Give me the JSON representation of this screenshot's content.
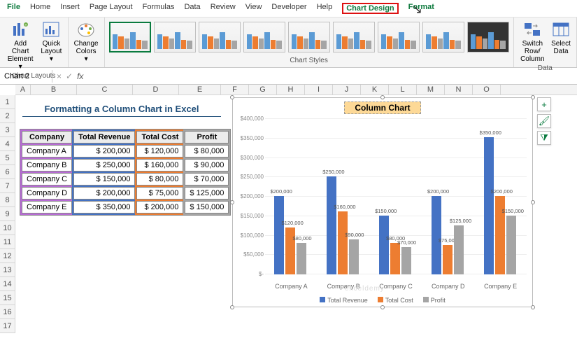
{
  "menu": {
    "file": "File",
    "home": "Home",
    "insert": "Insert",
    "pagelayout": "Page Layout",
    "formulas": "Formulas",
    "data": "Data",
    "review": "Review",
    "view": "View",
    "developer": "Developer",
    "help": "Help",
    "chartdesign": "Chart Design",
    "format": "Format"
  },
  "ribbon": {
    "addchart": "Add Chart\nElement ▾",
    "quicklayout": "Quick\nLayout ▾",
    "changecolors": "Change\nColors ▾",
    "switch": "Switch Row/\nColumn",
    "selectdata": "Select\nData",
    "g1": "Chart Layouts",
    "g2": "Chart Styles",
    "g3": "Data"
  },
  "namebox": "Chart 2",
  "titleblock": "Formatting a Column Chart in Excel",
  "headers": {
    "company": "Company",
    "rev": "Total Revenue",
    "cost": "Total Cost",
    "profit": "Profit"
  },
  "rows": [
    {
      "c": "Company A",
      "r": "$     200,000",
      "t": "$   120,000",
      "p": "$     80,000"
    },
    {
      "c": "Company B",
      "r": "$     250,000",
      "t": "$   160,000",
      "p": "$     90,000"
    },
    {
      "c": "Company C",
      "r": "$     150,000",
      "t": "$     80,000",
      "p": "$     70,000"
    },
    {
      "c": "Company D",
      "r": "$     200,000",
      "t": "$     75,000",
      "p": "$   125,000"
    },
    {
      "c": "Company E",
      "r": "$     350,000",
      "t": "$   200,000",
      "p": "$   150,000"
    }
  ],
  "chart": {
    "title": "Column Chart"
  },
  "yticks": [
    "$-",
    "$50,000",
    "$100,000",
    "$150,000",
    "$200,000",
    "$250,000",
    "$300,000",
    "$350,000",
    "$400,000"
  ],
  "legend": {
    "a": "Total Revenue",
    "b": "Total Cost",
    "c": "Profit"
  },
  "cols": [
    "A",
    "B",
    "C",
    "D",
    "E",
    "F",
    "G",
    "H",
    "I",
    "J",
    "K",
    "L",
    "M",
    "N",
    "O"
  ],
  "sidebtn": {
    "plus": "+",
    "brush": "🖌",
    "filter": "⧩"
  },
  "watermark": "exceldemy",
  "chart_data": {
    "type": "bar",
    "title": "Column Chart",
    "ylabel": "",
    "xlabel": "",
    "ylim": [
      0,
      400000
    ],
    "categories": [
      "Company A",
      "Company B",
      "Company C",
      "Company D",
      "Company E"
    ],
    "series": [
      {
        "name": "Total Revenue",
        "values": [
          200000,
          250000,
          150000,
          200000,
          350000
        ],
        "labels": [
          "$200,000",
          "$250,000",
          "$150,000",
          "$200,000",
          "$350,000"
        ]
      },
      {
        "name": "Total Cost",
        "values": [
          120000,
          160000,
          80000,
          75000,
          200000
        ],
        "labels": [
          "$120,000",
          "$160,000",
          "$80,000",
          "$75,000",
          "$200,000"
        ]
      },
      {
        "name": "Profit",
        "values": [
          80000,
          90000,
          70000,
          125000,
          150000
        ],
        "labels": [
          "$80,000",
          "$90,000",
          "$70,000",
          "$125,000",
          "$150,000"
        ]
      }
    ]
  }
}
